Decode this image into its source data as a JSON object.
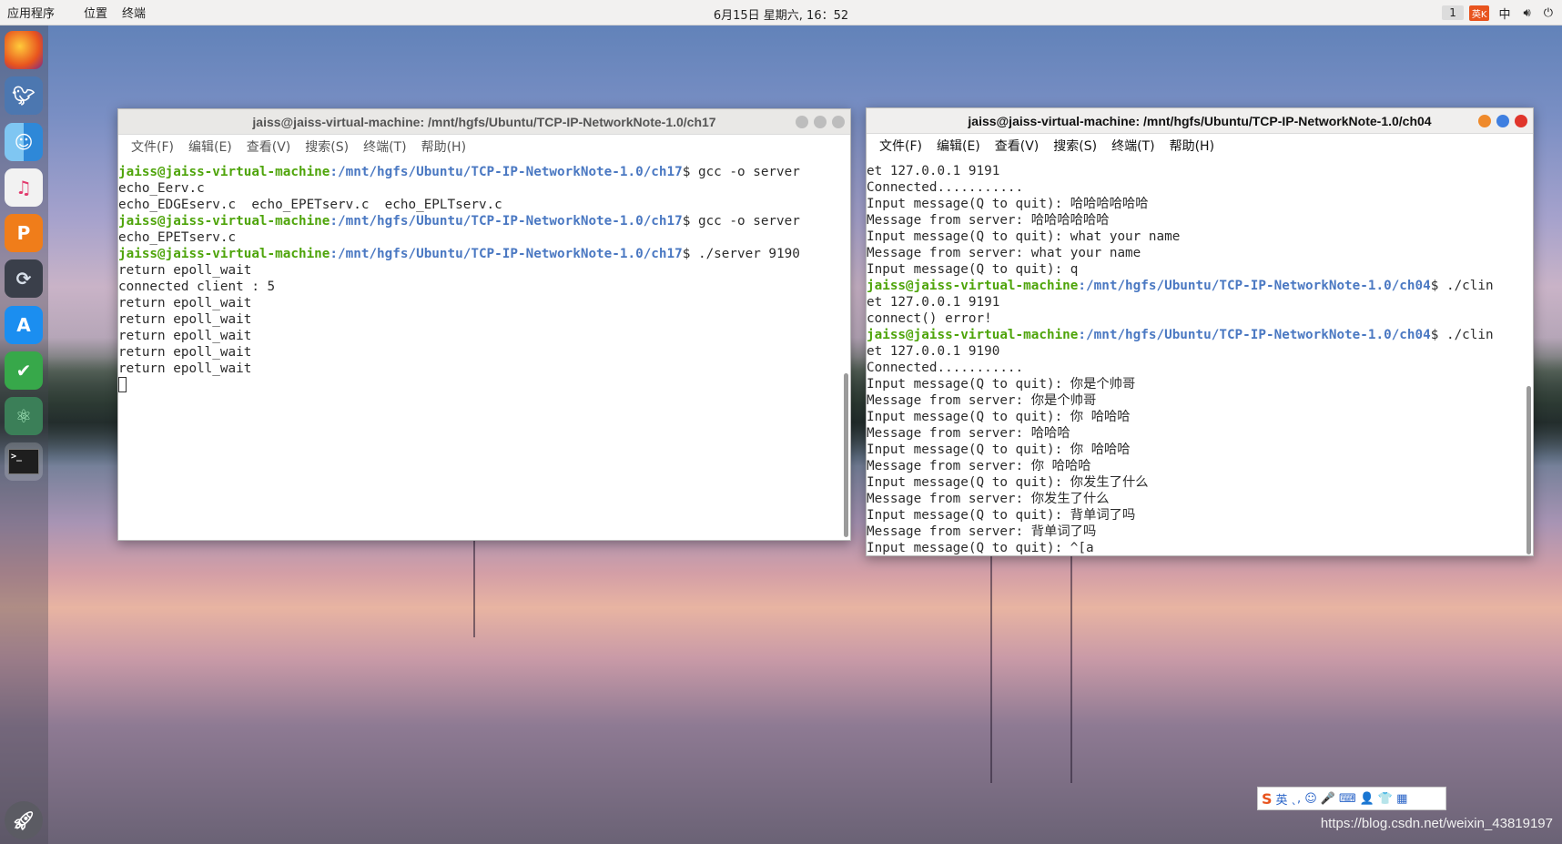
{
  "topbar": {
    "apps_menu": "应用程序",
    "places_menu": "位置",
    "terminal_menu": "终端",
    "clock": "6月15日 星期六, 16：52",
    "workspace": "1",
    "ime_badge": "英K",
    "input_lang": "中"
  },
  "dock": {
    "items": [
      "firefox-icon",
      "image-viewer-icon",
      "finder-icon",
      "music-icon",
      "presentation-icon",
      "sync-icon",
      "app-store-icon",
      "checkmark-app-icon",
      "atom-icon",
      "terminal-icon",
      "launcher-rocket-icon"
    ]
  },
  "left_window": {
    "title": "jaiss@jaiss-virtual-machine: /mnt/hgfs/Ubuntu/TCP-IP-NetworkNote-1.0/ch17",
    "menu": [
      "文件(F)",
      "编辑(E)",
      "查看(V)",
      "搜索(S)",
      "终端(T)",
      "帮助(H)"
    ],
    "lines": [
      {
        "user": "jaiss@jaiss-virtual-machine",
        "path": ":/mnt/hgfs/Ubuntu/TCP-IP-NetworkNote-1.0/ch17",
        "text": "$ gcc -o server "
      },
      {
        "text": "echo_Eerv.c"
      },
      {
        "text": "echo_EDGEserv.c  echo_EPETserv.c  echo_EPLTserv.c"
      },
      {
        "user": "jaiss@jaiss-virtual-machine",
        "path": ":/mnt/hgfs/Ubuntu/TCP-IP-NetworkNote-1.0/ch17",
        "text": "$ gcc -o server "
      },
      {
        "text": "echo_EPETserv.c"
      },
      {
        "user": "jaiss@jaiss-virtual-machine",
        "path": ":/mnt/hgfs/Ubuntu/TCP-IP-NetworkNote-1.0/ch17",
        "text": "$ ./server 9190"
      },
      {
        "text": "return epoll_wait"
      },
      {
        "text": "connected client : 5"
      },
      {
        "text": "return epoll_wait"
      },
      {
        "text": "return epoll_wait"
      },
      {
        "text": "return epoll_wait"
      },
      {
        "text": "return epoll_wait"
      },
      {
        "text": "return epoll_wait"
      }
    ]
  },
  "right_window": {
    "title": "jaiss@jaiss-virtual-machine: /mnt/hgfs/Ubuntu/TCP-IP-NetworkNote-1.0/ch04",
    "menu": [
      "文件(F)",
      "编辑(E)",
      "查看(V)",
      "搜索(S)",
      "终端(T)",
      "帮助(H)"
    ],
    "lines": [
      {
        "text": "et 127.0.0.1 9191"
      },
      {
        "text": "Connected..........."
      },
      {
        "text": "Input message(Q to quit): 哈哈哈哈哈哈"
      },
      {
        "text": "Message from server: 哈哈哈哈哈哈"
      },
      {
        "text": "Input message(Q to quit): what your name"
      },
      {
        "text": "Message from server: what your name"
      },
      {
        "text": "Input message(Q to quit): q"
      },
      {
        "user": "jaiss@jaiss-virtual-machine",
        "path": ":/mnt/hgfs/Ubuntu/TCP-IP-NetworkNote-1.0/ch04",
        "text": "$ ./clin"
      },
      {
        "text": "et 127.0.0.1 9191"
      },
      {
        "text": "connect() error!"
      },
      {
        "user": "jaiss@jaiss-virtual-machine",
        "path": ":/mnt/hgfs/Ubuntu/TCP-IP-NetworkNote-1.0/ch04",
        "text": "$ ./clin"
      },
      {
        "text": "et 127.0.0.1 9190"
      },
      {
        "text": "Connected..........."
      },
      {
        "text": "Input message(Q to quit): 你是个帅哥"
      },
      {
        "text": "Message from server: 你是个帅哥"
      },
      {
        "text": "Input message(Q to quit): 你 哈哈哈"
      },
      {
        "text": "Message from server: 哈哈哈"
      },
      {
        "text": "Input message(Q to quit): 你 哈哈哈"
      },
      {
        "text": "Message from server: 你 哈哈哈"
      },
      {
        "text": "Input message(Q to quit): 你发生了什么"
      },
      {
        "text": "Message from server: 你发生了什么"
      },
      {
        "text": "Input message(Q to quit): 背单词了吗"
      },
      {
        "text": "Message from server: 背单词了吗"
      },
      {
        "text": "Input message(Q to quit): ^[a"
      }
    ]
  },
  "ime_toolbar": {
    "logo": "S",
    "mode": "英",
    "symbols": [
      "ˎ,",
      "☺",
      "🎤",
      "⌨",
      "👤",
      "👕",
      "▦"
    ]
  },
  "watermark": "https://blog.csdn.net/weixin_43819197",
  "colors": {
    "prompt_user": "#4ea40a",
    "prompt_path": "#4a78c2",
    "close_button": "#e0352b",
    "minimize_button": "#ef8a2b",
    "maximize_button": "#3f7fe0"
  }
}
